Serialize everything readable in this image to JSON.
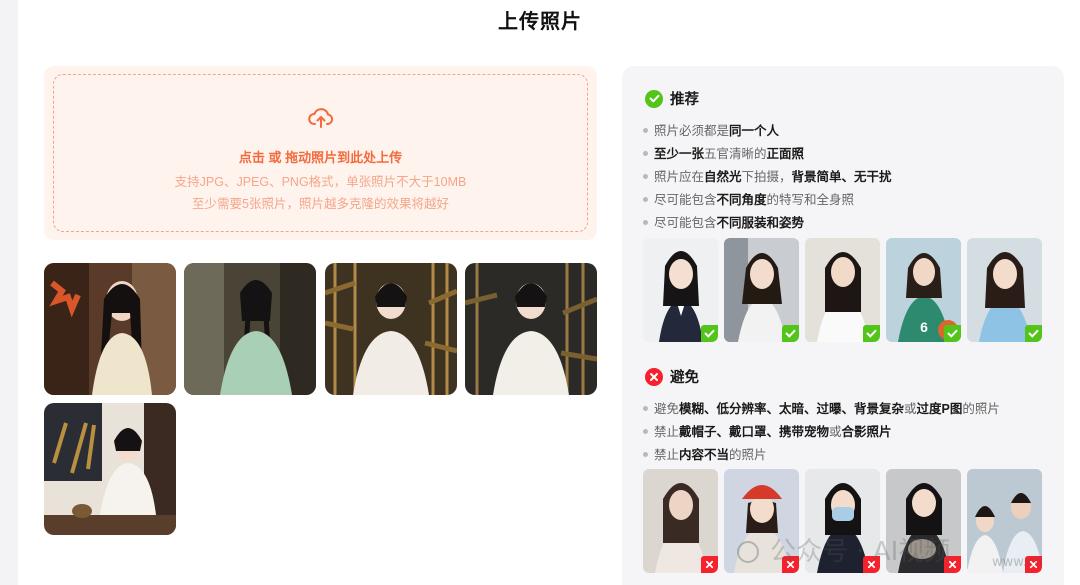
{
  "page": {
    "title": "上传照片"
  },
  "upload": {
    "main_prefix": "点击",
    "main_or": " 或 ",
    "main_suffix": "拖动照片到此处上传",
    "sub1": "支持JPG、JPEG、PNG格式，单张照片不大于10MB",
    "sub2": "至少需要5张照片，照片越多克隆的效果将越好"
  },
  "uploaded_photos": [
    {
      "name": "photo-1",
      "style": "warm-window"
    },
    {
      "name": "photo-2",
      "style": "green-dress"
    },
    {
      "name": "photo-3",
      "style": "bamboo-white"
    },
    {
      "name": "photo-4",
      "style": "bamboo-dark"
    },
    {
      "name": "photo-5",
      "style": "tea-table"
    }
  ],
  "recommend": {
    "title": "推荐",
    "rules": [
      [
        "照片必须都是",
        "",
        "同一个人",
        ""
      ],
      [
        "",
        "至少一张",
        "五官清晰的",
        "正面照"
      ],
      [
        "照片应在",
        "自然光",
        "下拍摄，",
        "背景简单、无干扰"
      ],
      [
        "尽可能包含",
        "不同角度",
        "的特写和全身照",
        ""
      ],
      [
        "尽可能包含",
        "不同服装和姿势",
        "",
        ""
      ]
    ],
    "samples": [
      "portrait-suit",
      "portrait-street",
      "portrait-white-tee",
      "portrait-basketball",
      "portrait-blue-top"
    ]
  },
  "avoid": {
    "title": "避免",
    "rule1": {
      "a": "避免",
      "b": "模糊、低分辨率、太暗、过曝、背景复杂",
      "c": "或",
      "d": "过度P图",
      "e": "的照片"
    },
    "rule2": {
      "a": "禁止",
      "b": "戴帽子、戴口罩、携带宠物",
      "c": "或",
      "d": "合影照片"
    },
    "rule3": {
      "a": "禁止",
      "b": "内容不当",
      "c": "的照片"
    },
    "samples": [
      "blurry",
      "hat",
      "mask",
      "pet",
      "group"
    ]
  },
  "watermark": {
    "text": "公众号 · AI视频",
    "site": "www.cn"
  },
  "colors": {
    "accent": "#f36a3c",
    "ok": "#52c41a",
    "bad": "#f5222d"
  }
}
